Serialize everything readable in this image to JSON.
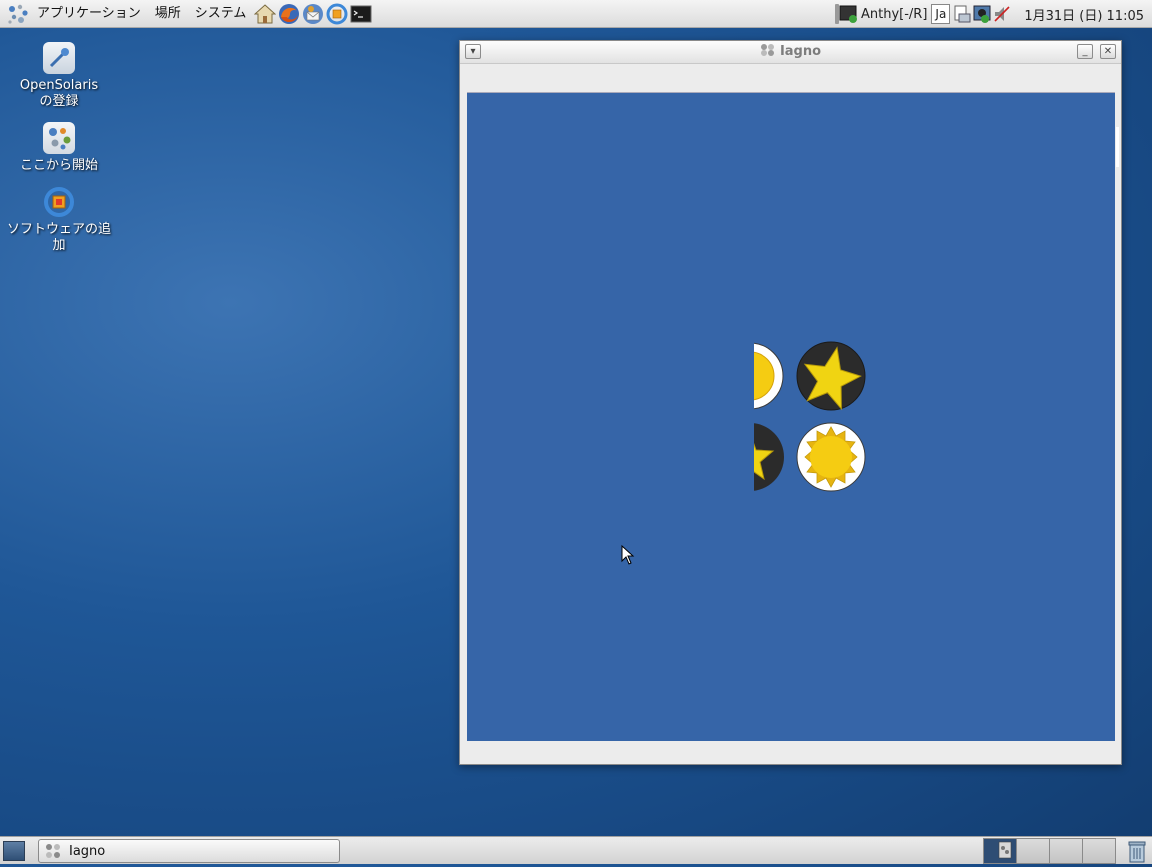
{
  "top_panel": {
    "menus": [
      "アプリケーション",
      "場所",
      "システム"
    ],
    "launchers": [
      "home-folder",
      "firefox",
      "thunderbird",
      "update-manager",
      "terminal"
    ],
    "tray": {
      "input_method": "Anthy[-/R]",
      "language": "Ja",
      "clock": "1月31日 (日) 11:05"
    }
  },
  "desktop_icons": [
    {
      "label_line1": "OpenSolaris",
      "label_line2": "の登録"
    },
    {
      "label_line1": "ここから開始",
      "label_line2": ""
    },
    {
      "label_line1": "ソフトウェアの追",
      "label_line2": "加"
    }
  ],
  "window": {
    "title": "Iagno",
    "board_color": "#3665a8",
    "pieces": [
      {
        "kind": "sun",
        "row": 0,
        "col": 0,
        "partial": true
      },
      {
        "kind": "star",
        "row": 0,
        "col": 1,
        "partial": false
      },
      {
        "kind": "star",
        "row": 1,
        "col": 0,
        "partial": true
      },
      {
        "kind": "sun",
        "row": 1,
        "col": 1,
        "partial": false
      }
    ]
  },
  "bottom_panel": {
    "task": "Iagno",
    "workspaces": 4,
    "active_workspace": 1
  },
  "colors": {
    "sun_fill": "#f5cc12",
    "star_fill": "#f0d412",
    "dark_piece": "#2b2b2b",
    "light_piece": "#ffffff"
  }
}
